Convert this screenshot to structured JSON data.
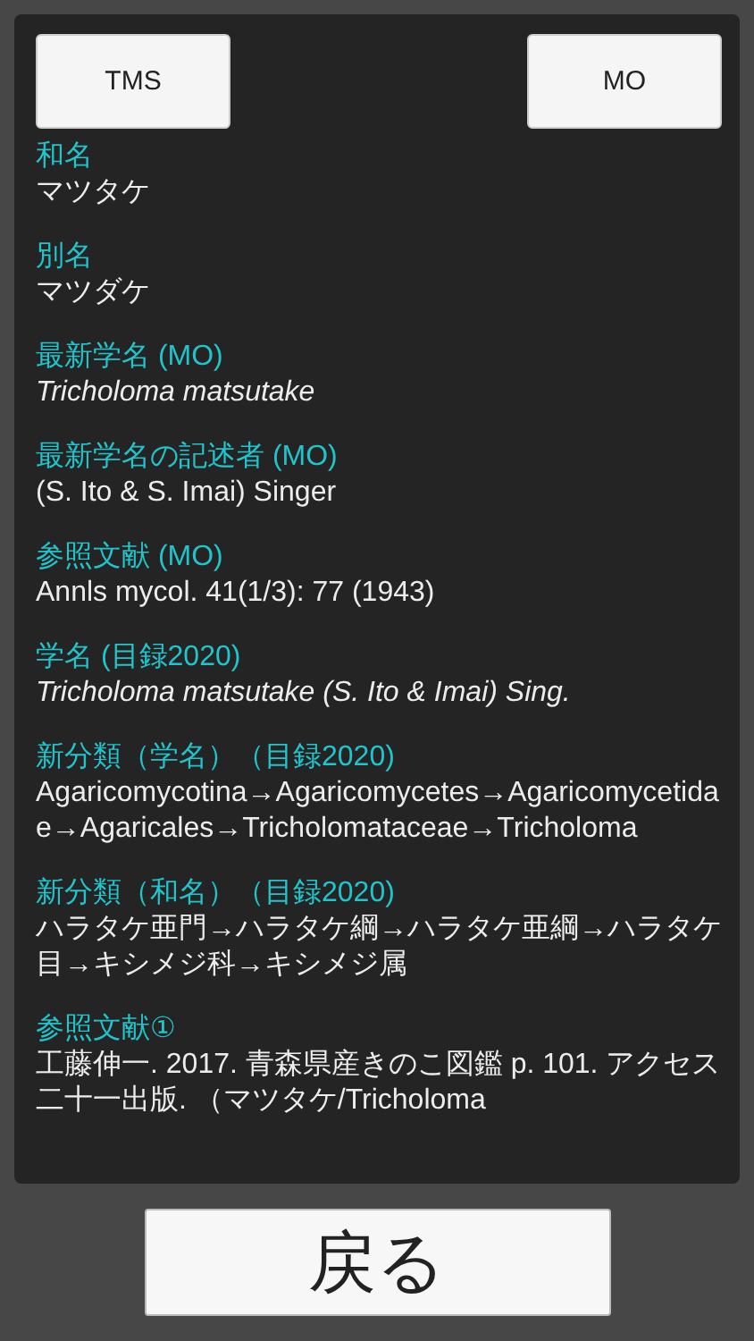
{
  "top_buttons": [
    {
      "label": "TMS"
    },
    {
      "label": "MO"
    }
  ],
  "fields": [
    {
      "label": "和名",
      "value": "マツタケ",
      "italic": false
    },
    {
      "label": "別名",
      "value": "マツダケ",
      "italic": false
    },
    {
      "label": "最新学名 (MO)",
      "value": "Tricholoma matsutake",
      "italic": true
    },
    {
      "label": "最新学名の記述者 (MO)",
      "value": "(S. Ito & S. Imai) Singer",
      "italic": false
    },
    {
      "label": "参照文献 (MO)",
      "value": "Annls mycol. 41(1/3): 77 (1943)",
      "italic": false
    },
    {
      "label": "学名 (目録2020)",
      "value": "Tricholoma matsutake (S. Ito & Imai) Sing.",
      "italic": true
    },
    {
      "label": "新分類（学名）（目録2020)",
      "value": "Agaricomycotina→Agaricomycetes→Agaricomycetidae→Agaricales→Tricholomataceae→Tricholoma",
      "italic": false
    },
    {
      "label": "新分類（和名）（目録2020)",
      "value": "ハラタケ亜門→ハラタケ綱→ハラタケ亜綱→ハラタケ目→キシメジ科→キシメジ属",
      "italic": false
    },
    {
      "label": "参照文献①",
      "value": "工藤伸一. 2017. 青森県産きのこ図鑑 p. 101. アクセス二十一出版. （マツタケ/Tricholoma",
      "italic": false
    }
  ],
  "back_button": {
    "label": "戻る"
  }
}
